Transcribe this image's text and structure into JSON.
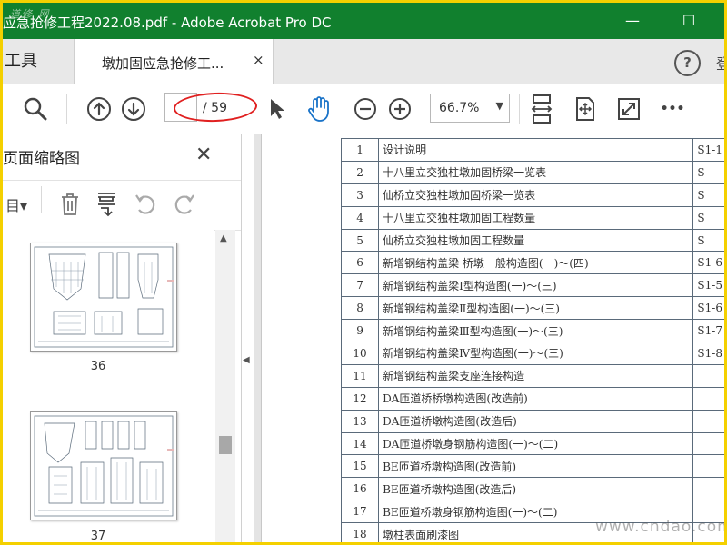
{
  "titlebar": {
    "watermark": "道修 网",
    "title": "应急抢修工程2022.08.pdf - Adobe Acrobat Pro DC",
    "minimize": "—",
    "maximize": "☐",
    "color": "#11802e"
  },
  "tabs": {
    "tools_label": "工具",
    "doc_label": "墩加固应急抢修工...",
    "doc_close": "×",
    "help": "?",
    "cut_text": "登"
  },
  "toolbar": {
    "page_current": "",
    "page_total": "/ 59",
    "zoom": "66.7%",
    "zoom_arrow": "▼",
    "more": "•••",
    "icons": [
      "search-icon",
      "page-up-icon",
      "page-down-icon",
      "select-pointer-icon",
      "hand-tool-icon",
      "zoom-out-icon",
      "zoom-in-icon",
      "fit-width-icon",
      "fit-page-icon",
      "full-screen-icon",
      "more-icon"
    ]
  },
  "left_panel": {
    "title": "页面缩略图",
    "close": "✕",
    "menu_icon": "目▾",
    "thumbnails": [
      {
        "label": "36"
      },
      {
        "label": "37"
      }
    ]
  },
  "watermark_bottom": "www.cndao.com",
  "document": {
    "rows": [
      {
        "num": "1",
        "name": "设计说明",
        "code": "S1-1"
      },
      {
        "num": "2",
        "name": "十八里立交独柱墩加固桥梁一览表",
        "code": "S"
      },
      {
        "num": "3",
        "name": "仙桥立交独柱墩加固桥梁一览表",
        "code": "S"
      },
      {
        "num": "4",
        "name": "十八里立交独柱墩加固工程数量",
        "code": "S"
      },
      {
        "num": "5",
        "name": "仙桥立交独柱墩加固工程数量",
        "code": "S"
      },
      {
        "num": "6",
        "name": "新增钢结构盖梁 桥墩一般构造图(一)～(四)",
        "code": "S1-6"
      },
      {
        "num": "7",
        "name": "新增钢结构盖梁Ⅰ型构造图(一)～(三)",
        "code": "S1-5"
      },
      {
        "num": "8",
        "name": "新增钢结构盖梁Ⅱ型构造图(一)～(三)",
        "code": "S1-6"
      },
      {
        "num": "9",
        "name": "新增钢结构盖梁Ⅲ型构造图(一)～(三)",
        "code": "S1-7"
      },
      {
        "num": "10",
        "name": "新增钢结构盖梁Ⅳ型构造图(一)～(三)",
        "code": "S1-8"
      },
      {
        "num": "11",
        "name": "新增钢结构盖梁支座连接构造",
        "code": ""
      },
      {
        "num": "12",
        "name": "DA匝道桥桥墩构造图(改造前)",
        "code": ""
      },
      {
        "num": "13",
        "name": "DA匝道桥墩构造图(改造后)",
        "code": ""
      },
      {
        "num": "14",
        "name": "DA匝道桥墩身钢筋构造图(一)～(二)",
        "code": ""
      },
      {
        "num": "15",
        "name": "BE匝道桥墩构造图(改造前)",
        "code": ""
      },
      {
        "num": "16",
        "name": "BE匝道桥墩构造图(改造后)",
        "code": ""
      },
      {
        "num": "17",
        "name": "BE匝道桥墩身钢筋构造图(一)～(二)",
        "code": ""
      },
      {
        "num": "18",
        "name": "墩柱表面刷漆图",
        "code": ""
      }
    ]
  }
}
